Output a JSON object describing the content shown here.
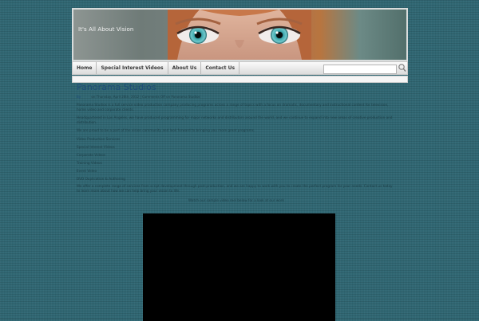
{
  "site": {
    "title": "It's All About Vision"
  },
  "nav": {
    "items": [
      "Home",
      "Special Interest Videos",
      "About Us",
      "Contact Us"
    ],
    "search_placeholder": ""
  },
  "post": {
    "title": "Panorama Studios",
    "meta_author": "By",
    "meta_text": "on Thursday, April 26th, 2012 | Comments Off on Panorama Studios",
    "paragraphs": [
      "Panorama Studios is a full service video production company producing programs across a range of topics with a focus on dramatic, documentary and instructional content for television, home video and corporate clients.",
      "Headquartered in Los Angeles, we have produced programming for major networks and distributors around the world, and we continue to expand into new areas of creative production and distribution.",
      "We are proud to be a part of the vision community and look forward to bringing you more great programs."
    ],
    "list": [
      "Video Production Services",
      "Special Interest Videos",
      "Corporate Videos",
      "Training Videos",
      "Event Video",
      "DVD Duplication & Authoring"
    ],
    "closing": "We offer a complete range of services from script development through post-production, and we are happy to work with you to create the perfect program for your needs. Contact us today to learn more about how we can help bring your vision to life.",
    "video_caption": "Watch our sample video reel below for a look at our work"
  }
}
